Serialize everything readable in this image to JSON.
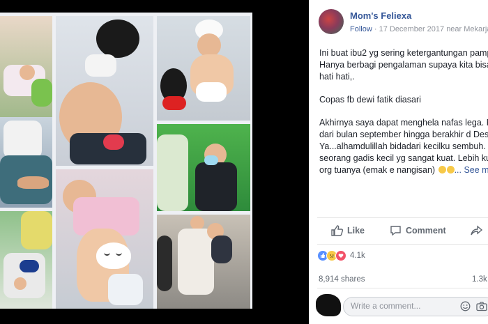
{
  "post": {
    "page_name": "Mom's Feliexa",
    "follow_label": "Follow",
    "separator": " · ",
    "date_location": "17 December 2017 near Mekarjay",
    "paragraphs": [
      [
        "Ini buat ibu2 yg sering ketergantungan pamp",
        "Hanya berbagi pengalaman supaya kita bisa",
        "hati hati,."
      ],
      [
        "Copas fb dewi fatik diasari"
      ],
      [
        "Akhirnya saya dapat menghela nafas lega. F",
        "dari bulan september hingga berakhir d Des",
        "Ya...alhamdulillah bidadari kecilku sembuh.",
        "seorang gadis kecil yg sangat kuat. Lebih ku"
      ]
    ],
    "last_line": "org tuanya (emak e nangisan)",
    "see_more_label": "... See m"
  },
  "actions": {
    "like_label": "Like",
    "comment_label": "Comment"
  },
  "stats": {
    "reaction_count": "4.1k",
    "shares_label": "8,914 shares",
    "comment_count": "1.3k"
  },
  "comment": {
    "placeholder": "Write a comment..."
  },
  "colors": {
    "link": "#365899",
    "like_blue": "#5890ff",
    "love_red": "#f25268",
    "sad_yellow": "#f7c948"
  },
  "icons": [
    "like-icon",
    "comment-icon",
    "share-icon",
    "emoji-icon",
    "camera-icon"
  ]
}
